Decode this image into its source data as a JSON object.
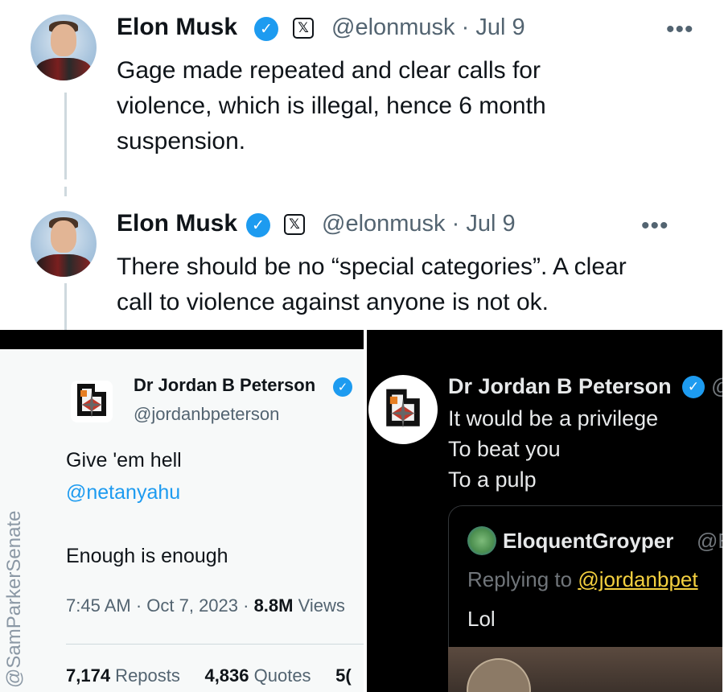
{
  "top_thread": [
    {
      "name": "Elon Musk",
      "verified_icon": "check",
      "x_badge": "𝕏",
      "handle": "@elonmusk · Jul 9",
      "more": "•••",
      "text_lines": [
        "Gage made repeated and clear calls for",
        "violence, which is illegal, hence 6 month",
        "suspension."
      ]
    },
    {
      "name": "Elon Musk",
      "verified_icon": "check",
      "x_badge": "𝕏",
      "handle": "@elonmusk · Jul 9",
      "more": "•••",
      "text_lines": [
        "There should be no “special categories”. A clear",
        "call to violence against anyone is not ok."
      ]
    }
  ],
  "left_tweet": {
    "name": "Dr Jordan B Peterson",
    "handle": "@jordanbpeterson",
    "line1": "Give 'em hell",
    "mention": "@netanyahu",
    "line3": "Enough is enough",
    "time": "7:45 AM · Oct 7, 2023 · ",
    "views_count": "8.8M",
    "views_label": " Views",
    "reposts_count": "7,174",
    "reposts_label": " Reposts",
    "quotes_count": "4,836",
    "quotes_label": " Quotes",
    "likes_partial": "5("
  },
  "right_tweet": {
    "name": "Dr Jordan B Peterson",
    "handle_partial": "@",
    "lines": [
      "It would be a privilege",
      "To beat you",
      "To a pulp"
    ],
    "quote": {
      "name": "EloquentGroyper",
      "handle_partial": "@E",
      "replying_prefix": "Replying to ",
      "replying_handle": "@jordanbpet",
      "text": "Lol"
    }
  },
  "watermark": "@SamParkerSenate",
  "colors": {
    "accent": "#1d9bf0",
    "link_dark": "#f4d03f",
    "text_dark_mode": "#e7e9ea",
    "muted": "#536471"
  }
}
